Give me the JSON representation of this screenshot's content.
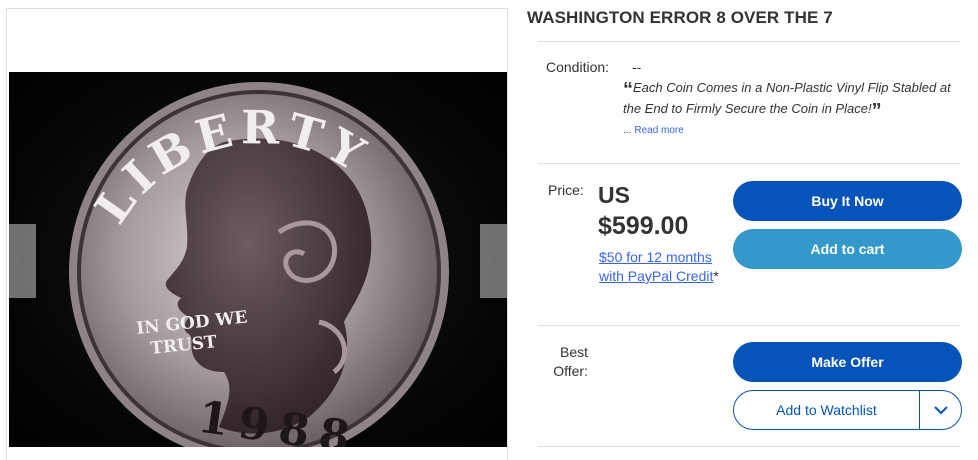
{
  "listing": {
    "title": "WASHINGTON ERROR 8 OVER THE 7"
  },
  "gallery": {
    "image_alt": "1988 Washington quarter coin showing LIBERTY, IN GOD WE TRUST and date 1988",
    "coin_text": {
      "liberty": "LIBERTY",
      "motto_line1": "IN GOD WE",
      "motto_line2": "TRUST",
      "date": "1988"
    },
    "prev_icon": "chevron-left-icon",
    "next_icon": "chevron-right-icon"
  },
  "condition": {
    "label": "Condition:",
    "value": "--",
    "description": "Each Coin Comes in a Non-Plastic Vinyl Flip Stabled at the End to Firmly Secure the Coin in Place!",
    "open_quote": "“",
    "close_quote": "”",
    "ellipsis": "...",
    "read_more": "Read more"
  },
  "price": {
    "label": "Price:",
    "currency": "US",
    "amount": "$599.00",
    "credit_link": "$50 for 12 months with PayPal Credit",
    "credit_asterisk": "*"
  },
  "actions": {
    "buy_now": "Buy It Now",
    "add_to_cart": "Add to cart",
    "make_offer": "Make Offer",
    "add_to_watchlist": "Add to Watchlist",
    "watchlist_dropdown_icon": "chevron-down-icon"
  },
  "best_offer": {
    "label": "Best Offer:"
  },
  "colors": {
    "primary_button": "#0654ba",
    "secondary_button": "#3498ca",
    "link": "#3665f3"
  }
}
